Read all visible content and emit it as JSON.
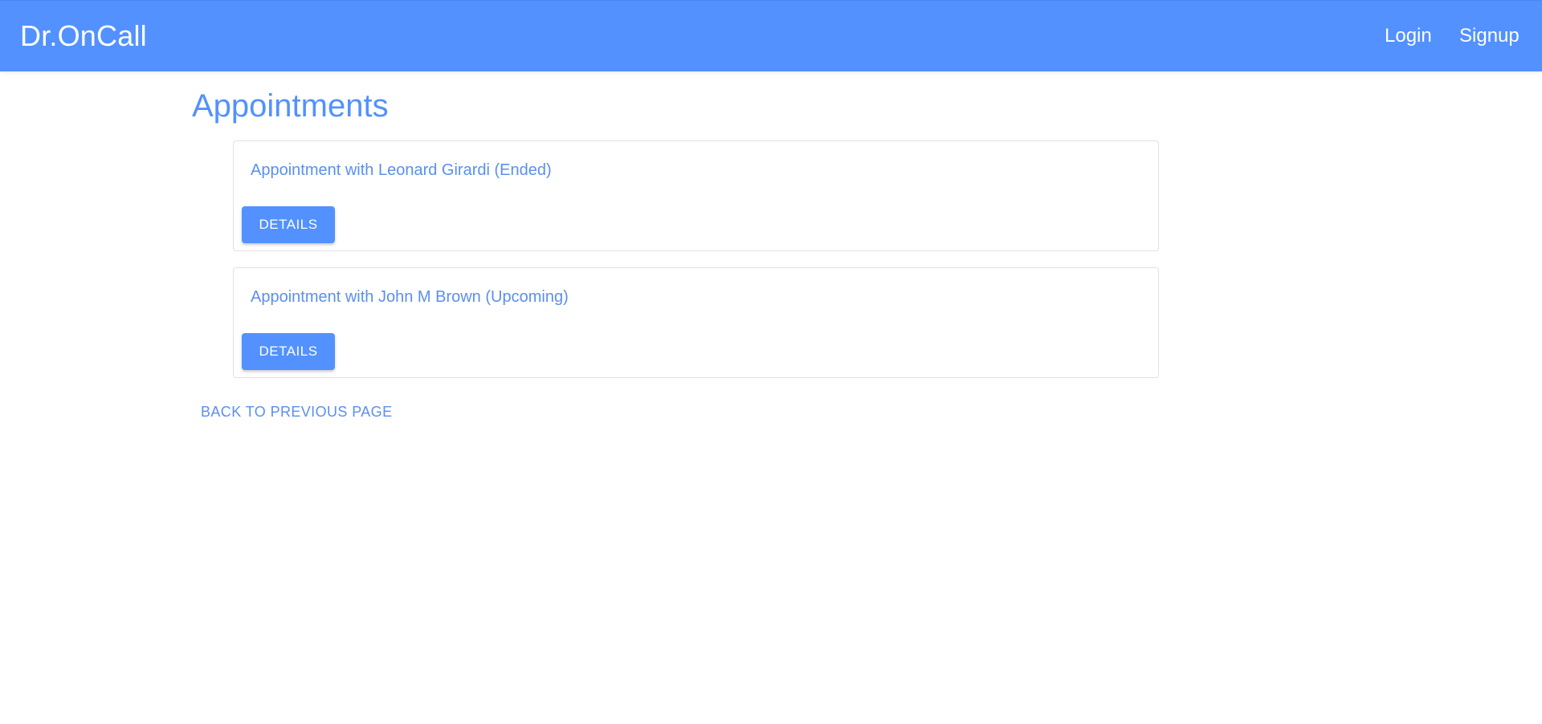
{
  "app_bar": {
    "brand": "Dr.OnCall",
    "nav": {
      "login": "Login",
      "signup": "Signup"
    },
    "background": "#5291ff"
  },
  "main": {
    "title": "Appointments",
    "appointments": [
      {
        "title": "Appointment with Leonard Girardi (Ended)",
        "button_label": "DETAILS"
      },
      {
        "title": "Appointment with John M Brown (Upcoming)",
        "button_label": "DETAILS"
      }
    ],
    "back_label": "BACK TO PREVIOUS PAGE"
  },
  "colors": {
    "accent": "#5291ff",
    "text_link": "#5a8ff0",
    "card_border": "#e1e1e1"
  }
}
